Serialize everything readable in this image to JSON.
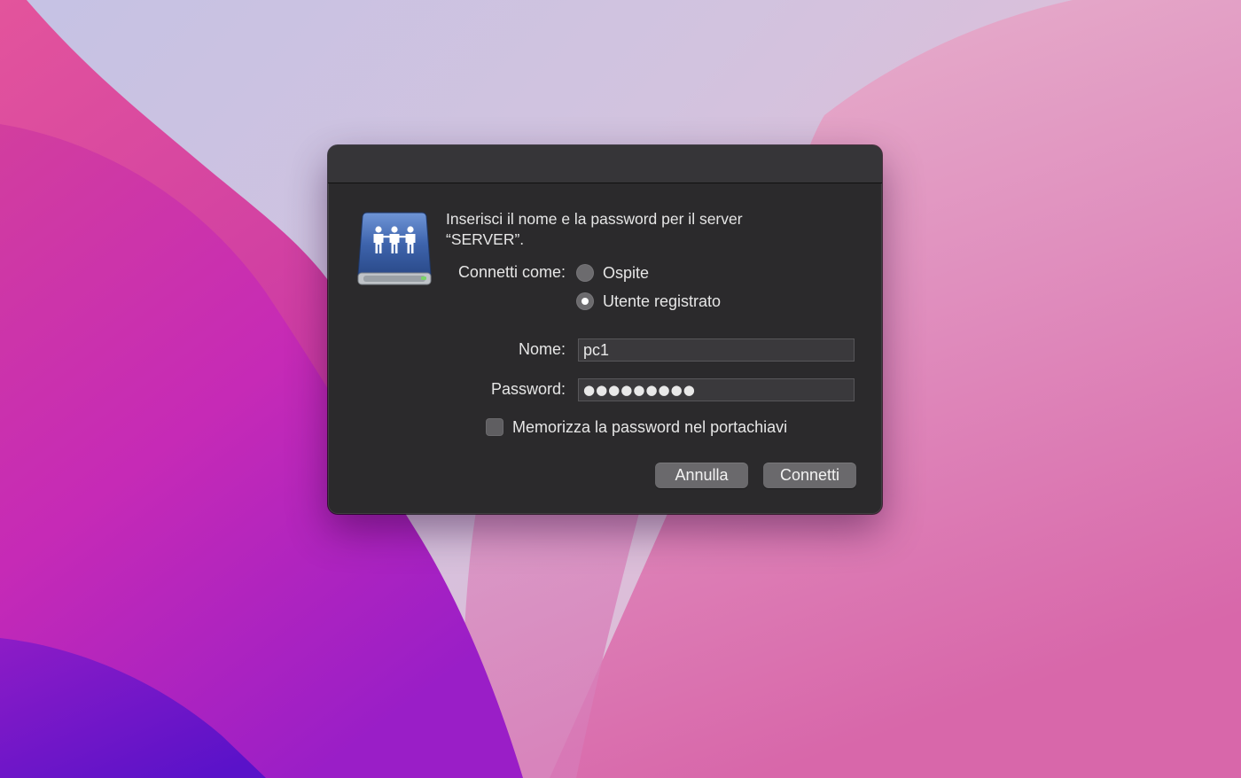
{
  "dialog": {
    "message": "Inserisci il nome e la password per il server\n“SERVER”.",
    "connect_as_label": "Connetti come:",
    "radio_guest_label": "Ospite",
    "radio_registered_label": "Utente registrato",
    "selected_option": "Utente registrato",
    "name_label": "Nome:",
    "name_value": "pc1",
    "password_label": "Password:",
    "password_value": "●●●●●●●●●",
    "remember_label": "Memorizza la password nel portachiavi",
    "remember_checked": false,
    "cancel_label": "Annulla",
    "connect_label": "Connetti"
  },
  "icons": {
    "server": "network-server-icon"
  },
  "colors": {
    "dialog_bg": "#2b2a2c",
    "titlebar_bg": "#363538",
    "button_bg": "#6a696c",
    "icon_blue": "#3a5fa6"
  }
}
